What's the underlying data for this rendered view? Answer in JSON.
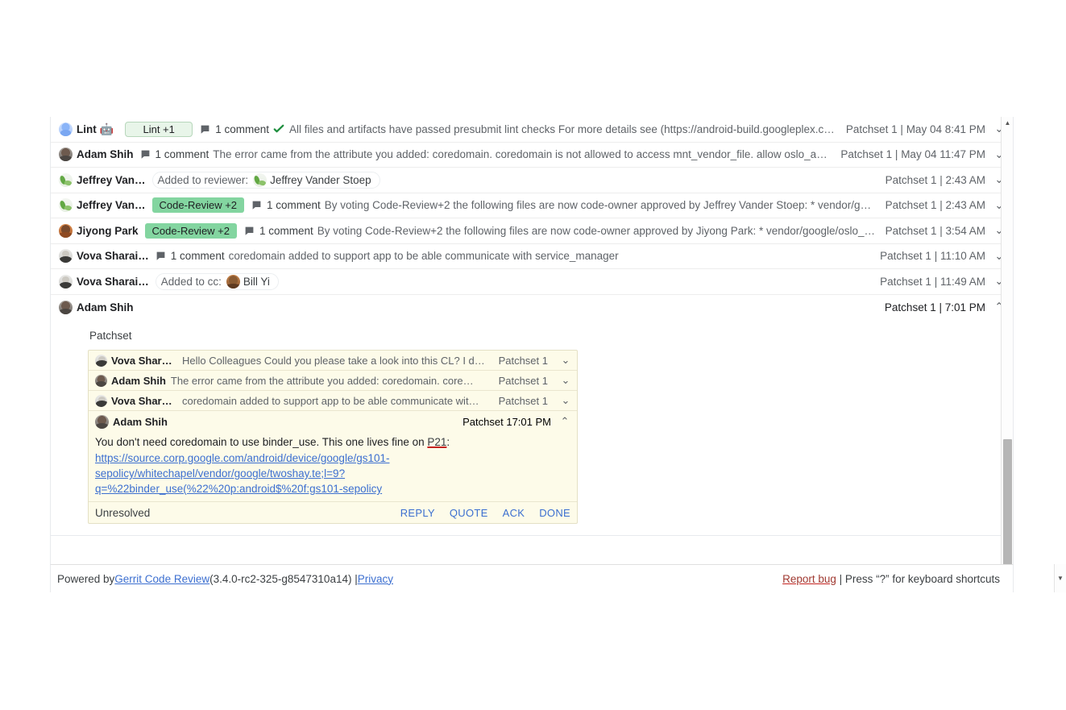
{
  "messages": [
    {
      "author": "Lint",
      "avatar": "av-lint",
      "bot_emoji": "🤖",
      "vote": "Lint +1",
      "vote_style": "lint",
      "comment_count": "1 comment",
      "has_check": true,
      "text": "All files and artifacts have passed presubmit lint checks For more details see (https://android-build.googleplex.c…",
      "patchset": "Patchset 1 | May 04 8:41 PM",
      "chevron": "⌄"
    },
    {
      "author": "Adam Shih",
      "avatar": "av-adam",
      "comment_count": "1 comment",
      "text": "The error came from the attribute you added: coredomain. coredomain is not allowed to access mnt_vendor_file. allow oslo_app …",
      "patchset": "Patchset 1 | May 04 11:47 PM",
      "chevron": "⌄"
    },
    {
      "author": "Jeffrey Van…",
      "avatar": "av-jeff",
      "reviewer_pill": {
        "label": "Added to reviewer:",
        "avatar": "av-jeff",
        "name": "Jeffrey Vander Stoep"
      },
      "patchset": "Patchset 1 | 2:43 AM",
      "chevron": "⌄"
    },
    {
      "author": "Jeffrey Van…",
      "avatar": "av-jeff",
      "vote": "Code-Review +2",
      "vote_style": "cr2",
      "comment_count": "1 comment",
      "text": "By voting Code-Review+2 the following files are now code-owner approved by Jeffrey Vander Stoep: * vendor/google/…",
      "patchset": "Patchset 1 | 2:43 AM",
      "chevron": "⌄"
    },
    {
      "author": "Jiyong Park",
      "avatar": "av-jiyong",
      "vote": "Code-Review +2",
      "vote_style": "cr2",
      "comment_count": "1 comment",
      "text": "By voting Code-Review+2 the following files are now code-owner approved by Jiyong Park: * vendor/google/oslo_app.te",
      "patchset": "Patchset 1 | 3:54 AM",
      "chevron": "⌄"
    },
    {
      "author": "Vova Sharai…",
      "avatar": "av-vova",
      "comment_count": "1 comment",
      "text": "coredomain added to support app to be able communicate with service_manager",
      "patchset": "Patchset 1 | 11:10 AM",
      "chevron": "⌄"
    },
    {
      "author": "Vova Sharai…",
      "avatar": "av-vova",
      "reviewer_pill": {
        "label": "Added to cc:",
        "avatar": "av-bill",
        "name": "Bill Yi"
      },
      "patchset": "Patchset 1 | 11:49 AM",
      "chevron": "⌄"
    }
  ],
  "expanded_message": {
    "author": "Adam Shih",
    "avatar": "av-adam",
    "patchset": "Patchset 1 | 7:01 PM",
    "chevron": "⌃",
    "section_heading": "Patchset",
    "thread": {
      "collapsed_comments": [
        {
          "author": "Vova Sharaie…",
          "avatar": "av-vova",
          "snippet": "Hello Colleagues Could you please take a look into this CL? I d…",
          "patchset": "Patchset 1",
          "chevron": "⌄"
        },
        {
          "author": "Adam Shih",
          "avatar": "av-adam",
          "snippet": "The error came from the attribute you added: coredomain. core…",
          "patchset": "Patchset 1",
          "chevron": "⌄"
        },
        {
          "author": "Vova Sharaie…",
          "avatar": "av-vova",
          "snippet": "coredomain added to support app to be able communicate wit…",
          "patchset": "Patchset 1",
          "chevron": "⌄"
        }
      ],
      "open_comment": {
        "author": "Adam Shih",
        "avatar": "av-adam",
        "patchset": "Patchset 1",
        "time": "7:01 PM",
        "chevron": "⌃",
        "body_prefix": "You don't need coredomain to use binder_use. This one lives fine on ",
        "body_link_inline": "P21",
        "body_suffix": ":",
        "url_line_1": "https://source.corp.google.com/android/device/google/gs101-",
        "url_line_2": "sepolicy/whitechapel/vendor/google/twoshay.te;l=9?",
        "url_line_3": "q=%22binder_use(%22%20p:android$%20f:gs101-sepolicy",
        "status": "Unresolved",
        "actions": [
          "REPLY",
          "QUOTE",
          "ACK",
          "DONE"
        ]
      }
    }
  },
  "footer": {
    "powered_by": "Powered by ",
    "gerrit_link": "Gerrit Code Review",
    "version": " (3.4.0-rc2-325-g8547310a14) | ",
    "privacy_link": "Privacy",
    "report_bug": "Report bug",
    "shortcuts_text": " | Press “?” for keyboard shortcuts"
  },
  "colors": {
    "vote_cr2_bg": "#83d5a0",
    "vote_lint_bg": "#e8f5e9",
    "thread_bg": "#fdfbe9",
    "link": "#3c6fd0",
    "action": "#3b6fd0",
    "check": "#188038"
  }
}
